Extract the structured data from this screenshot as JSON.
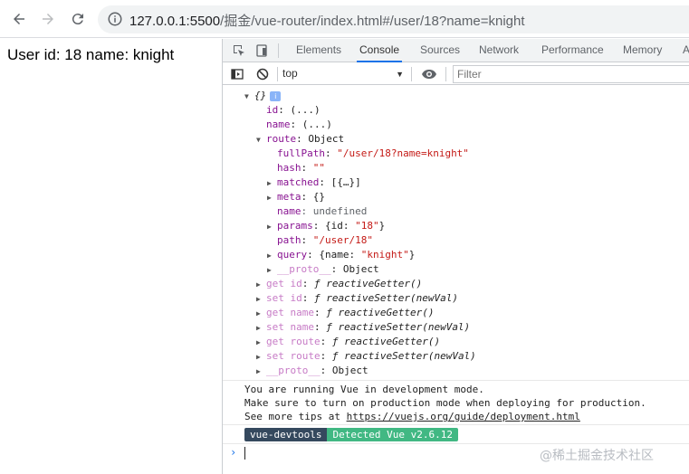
{
  "browser": {
    "url_host": "127.0.0.1:5500",
    "url_path": "/掘金/vue-router/index.html#/user/18?name=knight"
  },
  "page": {
    "text": "User id: 18 name: knight"
  },
  "devtools": {
    "tabs": [
      "Elements",
      "Console",
      "Sources",
      "Network",
      "Performance",
      "Memory",
      "A"
    ],
    "active_tab": "Console",
    "context": "top",
    "filter_placeholder": "Filter"
  },
  "console": {
    "lines": {
      "obj_open": "{}",
      "id_key": "id",
      "id_val": ": (...)",
      "name_key": "name",
      "name_val": ": (...)",
      "route_key": "route",
      "route_val": ": Object",
      "fullpath_key": "fullPath",
      "fullpath_val": "\"/user/18?name=knight\"",
      "hash_key": "hash",
      "hash_val": "\"\"",
      "matched_key": "matched",
      "matched_val": ": [{…}]",
      "meta_key": "meta",
      "meta_val": ": {}",
      "name2_key": "name",
      "name2_val": ": undefined",
      "params_key": "params",
      "params_pre": ": {id: ",
      "params_str": "\"18\"",
      "params_post": "}",
      "path_key": "path",
      "path_val": "\"/user/18\"",
      "query_key": "query",
      "query_pre": ": {name: ",
      "query_str": "\"knight\"",
      "query_post": "}",
      "proto1_key": "__proto__",
      "proto1_val": ": Object",
      "get_id_key": "get id",
      "get_id_val": "reactiveGetter()",
      "set_id_key": "set id",
      "set_id_val": "reactiveSetter(newVal)",
      "get_name_key": "get name",
      "get_name_val": "reactiveGetter()",
      "set_name_key": "set name",
      "set_name_val": "reactiveSetter(newVal)",
      "get_route_key": "get route",
      "get_route_val": "reactiveGetter()",
      "set_route_key": "set route",
      "set_route_val": "reactiveSetter(newVal)",
      "proto2_key": "__proto__",
      "proto2_val": ": Object",
      "f_glyph": "ƒ"
    },
    "vue_msg": {
      "line1": "You are running Vue in development mode.",
      "line2": "Make sure to turn on production mode when deploying for production.",
      "line3_pre": "See more tips at ",
      "line3_link": "https://vuejs.org/guide/deployment.html"
    },
    "badge_left": "vue-devtools",
    "badge_right": "Detected Vue v2.6.12",
    "prompt": "›"
  },
  "watermark": "@稀土掘金技术社区"
}
